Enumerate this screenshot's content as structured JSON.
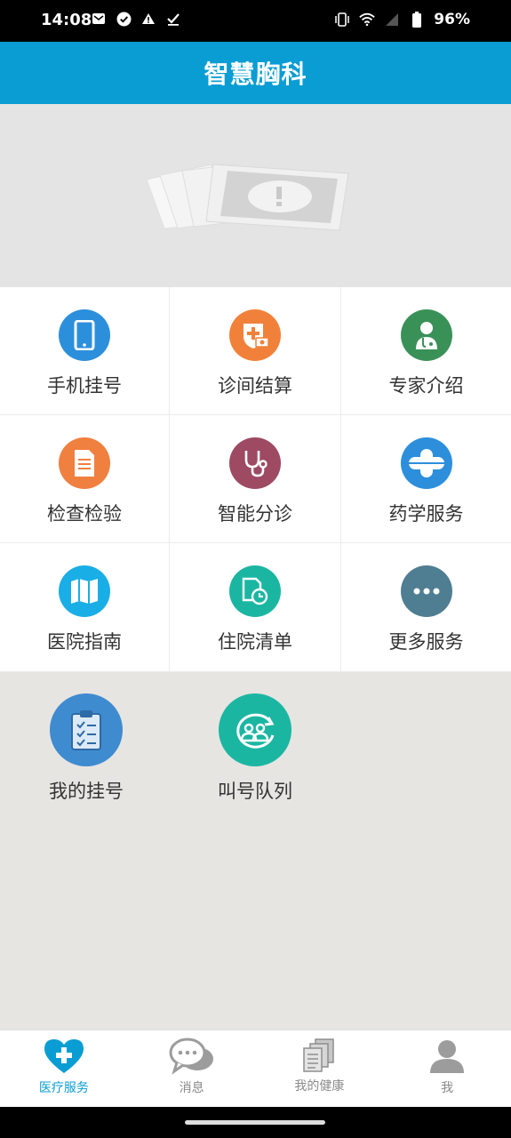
{
  "status_bar": {
    "time": "14:08",
    "battery": "96%",
    "icons_left": [
      "mail-icon",
      "check-circle-icon",
      "warning-icon",
      "check-icon"
    ],
    "icons_right": [
      "vibrate-icon",
      "wifi-icon",
      "signal-icon",
      "battery-icon"
    ]
  },
  "header": {
    "title": "智慧胸科"
  },
  "grid": {
    "items": [
      {
        "label": "手机挂号",
        "icon": "phone-icon",
        "color": "#2c8fdc"
      },
      {
        "label": "诊间结算",
        "icon": "medical-card-icon",
        "color": "#f1813a"
      },
      {
        "label": "专家介绍",
        "icon": "doctor-icon",
        "color": "#3a9158"
      },
      {
        "label": "检查检验",
        "icon": "document-icon",
        "color": "#f0803f"
      },
      {
        "label": "智能分诊",
        "icon": "stethoscope-icon",
        "color": "#9e4a63"
      },
      {
        "label": "药学服务",
        "icon": "pill-icon",
        "color": "#2d8fdc"
      },
      {
        "label": "医院指南",
        "icon": "map-icon",
        "color": "#1aaee6"
      },
      {
        "label": "住院清单",
        "icon": "clipboard-clock-icon",
        "color": "#1bb6a2"
      },
      {
        "label": "更多服务",
        "icon": "more-icon",
        "color": "#4f7d92"
      }
    ]
  },
  "quick": [
    {
      "label": "我的挂号",
      "icon": "clipboard-list-icon",
      "color": "#3f8bd0"
    },
    {
      "label": "叫号队列",
      "icon": "queue-icon",
      "color": "#1bb6a2"
    }
  ],
  "tabs": [
    {
      "label": "医疗服务",
      "icon": "heart-plus-icon",
      "active": true
    },
    {
      "label": "消息",
      "icon": "chat-icon",
      "active": false
    },
    {
      "label": "我的健康",
      "icon": "files-icon",
      "active": false
    },
    {
      "label": "我",
      "icon": "user-icon",
      "active": false
    }
  ]
}
